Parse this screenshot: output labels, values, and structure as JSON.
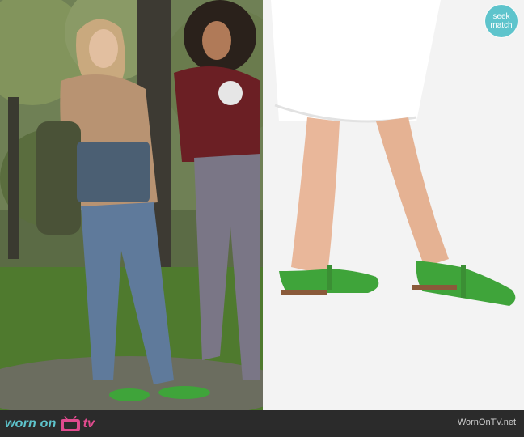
{
  "badge": {
    "line1": "seek",
    "line2": "match"
  },
  "footer": {
    "logo_main": "worn on",
    "logo_tv": "tv",
    "site_name": "WornOnTV.net"
  },
  "colors": {
    "brand_teal": "#5ec4cc",
    "brand_pink": "#e04b8e",
    "shoe_green": "#3fa43a",
    "footer_bg": "#2b2b2b"
  },
  "icons": {
    "badge": "seek-match-badge",
    "logo": "tv-icon"
  }
}
